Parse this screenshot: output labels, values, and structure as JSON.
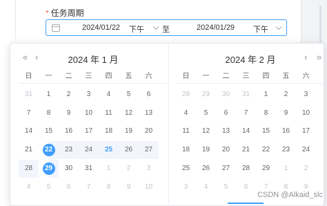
{
  "form": {
    "required_mark": "*",
    "label": "任务周期",
    "start_date": "2024/01/22",
    "start_ampm": "下午",
    "separator": "至",
    "end_date": "2024/01/29",
    "end_ampm": "下午"
  },
  "picker": {
    "nav_prev_year": "«",
    "nav_prev_month": "‹",
    "nav_next_month": "›",
    "nav_next_year": "»",
    "weekdays": [
      "日",
      "一",
      "二",
      "三",
      "四",
      "五",
      "六"
    ],
    "left": {
      "title": "2024 年 1 月",
      "rows": [
        [
          {
            "d": "31",
            "o": true
          },
          {
            "d": "1"
          },
          {
            "d": "2"
          },
          {
            "d": "3"
          },
          {
            "d": "4"
          },
          {
            "d": "5"
          },
          {
            "d": "6"
          }
        ],
        [
          {
            "d": "7"
          },
          {
            "d": "8"
          },
          {
            "d": "9"
          },
          {
            "d": "10"
          },
          {
            "d": "11"
          },
          {
            "d": "12"
          },
          {
            "d": "13"
          }
        ],
        [
          {
            "d": "14"
          },
          {
            "d": "15"
          },
          {
            "d": "16"
          },
          {
            "d": "17"
          },
          {
            "d": "18"
          },
          {
            "d": "19"
          },
          {
            "d": "20"
          }
        ],
        [
          {
            "d": "21"
          },
          {
            "d": "22",
            "s": "start"
          },
          {
            "d": "23",
            "r": true
          },
          {
            "d": "24",
            "r": true
          },
          {
            "d": "25",
            "r": true,
            "t": true
          },
          {
            "d": "26",
            "r": true
          },
          {
            "d": "27",
            "r": true
          }
        ],
        [
          {
            "d": "28",
            "r": true
          },
          {
            "d": "29",
            "s": "end"
          },
          {
            "d": "30"
          },
          {
            "d": "31"
          },
          {
            "d": "1",
            "o": true
          },
          {
            "d": "2",
            "o": true
          },
          {
            "d": "3",
            "o": true
          }
        ],
        [
          {
            "d": "4",
            "o": true
          },
          {
            "d": "5",
            "o": true
          },
          {
            "d": "6",
            "o": true
          },
          {
            "d": "7",
            "o": true
          },
          {
            "d": "8",
            "o": true
          },
          {
            "d": "9",
            "o": true
          },
          {
            "d": "10",
            "o": true
          }
        ]
      ]
    },
    "right": {
      "title": "2024 年 2 月",
      "rows": [
        [
          {
            "d": "28",
            "o": true
          },
          {
            "d": "29",
            "o": true
          },
          {
            "d": "30",
            "o": true
          },
          {
            "d": "31",
            "o": true
          },
          {
            "d": "1"
          },
          {
            "d": "2"
          },
          {
            "d": "3"
          }
        ],
        [
          {
            "d": "4"
          },
          {
            "d": "5"
          },
          {
            "d": "6"
          },
          {
            "d": "7"
          },
          {
            "d": "8"
          },
          {
            "d": "9"
          },
          {
            "d": "10"
          }
        ],
        [
          {
            "d": "11"
          },
          {
            "d": "12"
          },
          {
            "d": "13"
          },
          {
            "d": "14"
          },
          {
            "d": "15"
          },
          {
            "d": "16"
          },
          {
            "d": "17"
          }
        ],
        [
          {
            "d": "18"
          },
          {
            "d": "19"
          },
          {
            "d": "20"
          },
          {
            "d": "21"
          },
          {
            "d": "22"
          },
          {
            "d": "23"
          },
          {
            "d": "24"
          }
        ],
        [
          {
            "d": "25"
          },
          {
            "d": "26"
          },
          {
            "d": "27"
          },
          {
            "d": "28"
          },
          {
            "d": "29"
          },
          {
            "d": "1",
            "o": true
          },
          {
            "d": "2",
            "o": true
          }
        ],
        [
          {
            "d": "3",
            "o": true
          },
          {
            "d": "4",
            "o": true
          },
          {
            "d": "5",
            "o": true
          },
          {
            "d": "6",
            "o": true
          },
          {
            "d": "7",
            "o": true
          },
          {
            "d": "8",
            "o": true
          },
          {
            "d": "9",
            "o": true
          }
        ]
      ]
    }
  },
  "watermark": "CSDN @Alkaid_slc",
  "colors": {
    "accent": "#409eff",
    "range_bg": "#f2f6fc",
    "required": "#f56c6c",
    "muted": "#c0c4cc"
  }
}
